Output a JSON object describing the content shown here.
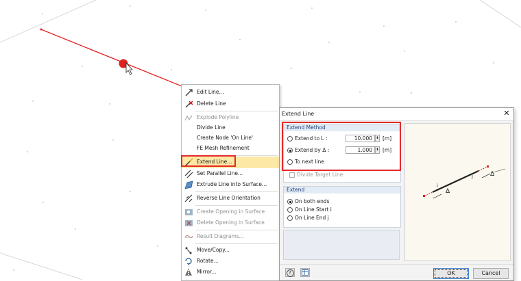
{
  "context_menu": {
    "items": [
      {
        "label": "Edit Line...",
        "disabled": false,
        "icon": "edit-line-icon"
      },
      {
        "label": "Delete Line",
        "disabled": false,
        "icon": "delete-line-icon"
      },
      {
        "label": "Explode Polyline",
        "disabled": true,
        "icon": "explode-polyline-icon"
      },
      {
        "label": "Divide Line",
        "disabled": false,
        "icon": ""
      },
      {
        "label": "Create Node 'On Line'",
        "disabled": false,
        "icon": ""
      },
      {
        "label": "FE Mesh Refinement",
        "disabled": false,
        "icon": ""
      },
      {
        "label": "Extend Line...",
        "disabled": false,
        "icon": "extend-line-icon",
        "highlighted": true
      },
      {
        "label": "Set Parallel Line...",
        "disabled": false,
        "icon": "parallel-line-icon"
      },
      {
        "label": "Extrude Line into Surface...",
        "disabled": false,
        "icon": "extrude-surface-icon"
      },
      {
        "label": "Reverse Line Orientation",
        "disabled": false,
        "icon": "reverse-orientation-icon"
      },
      {
        "label": "Create Opening in Surface",
        "disabled": true,
        "icon": "opening-icon"
      },
      {
        "label": "Delete Opening in Surface",
        "disabled": true,
        "icon": "delete-opening-icon"
      },
      {
        "label": "Result Diagrams...",
        "disabled": true,
        "icon": "result-diagram-icon"
      },
      {
        "label": "Move/Copy...",
        "disabled": false,
        "icon": "move-copy-icon"
      },
      {
        "label": "Rotate...",
        "disabled": false,
        "icon": "rotate-icon"
      },
      {
        "label": "Mirror...",
        "disabled": false,
        "icon": "mirror-icon"
      }
    ]
  },
  "dialog": {
    "title": "Extend Line",
    "extend_method": {
      "heading": "Extend Method",
      "option_length": "Extend to L :",
      "length_value": "10.000",
      "length_unit": "[m]",
      "option_delta": "Extend by Δ :",
      "delta_value": "1.000",
      "delta_unit": "[m]",
      "option_next": "To next line",
      "divide_target": "Divide Target Line",
      "selected": "delta"
    },
    "extend": {
      "heading": "Extend",
      "option_both": "On both ends",
      "option_start": "On Line Start i",
      "option_end": "On Line End j",
      "selected": "both"
    },
    "preview": {
      "label_i": "i",
      "label_j": "j",
      "delta": "Δ"
    },
    "ok_label": "OK",
    "cancel_label": "Cancel"
  },
  "colors": {
    "highlight_red": "#e32a2a",
    "menu_hover": "#fde8a6",
    "group_header": "#e3ebf5"
  }
}
